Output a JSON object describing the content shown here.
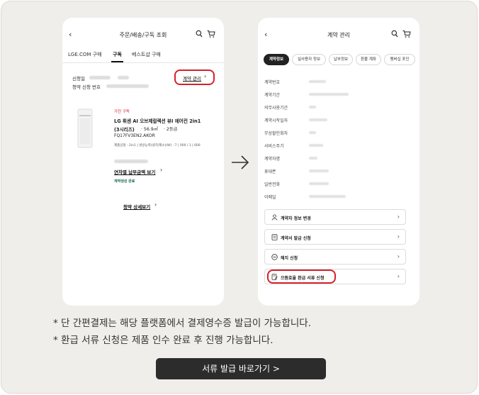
{
  "left": {
    "header": {
      "title": "주문/배송/구독 조회"
    },
    "tabs": [
      "LGE.COM 구매",
      "구독",
      "베스트샵 구매"
    ],
    "apply_date_label": "신청일",
    "contract_no_label": "청약 신청 번호",
    "contract_manage_link": "계약 관리",
    "product": {
      "category": "가전 구독",
      "name_line1": "LG 휘센 AI 오브제컬렉션 뷰I 에어컨 2in1",
      "name_line2": "(3시리즈)",
      "area": "· 56.9㎡",
      "grade": "· 2등급",
      "model": "FQ17FV3EN2.AKOR",
      "spec": "제품상형 : 2in1 | 냉방능력(냉치/제소)(W) : 7 | 000 / 1 | 600",
      "yearly_payment_link": "연차별 납부금액 보기",
      "status": "계약생성 완료"
    },
    "detail_link": "청약 상세보기"
  },
  "right": {
    "header": {
      "title": "계약 관리"
    },
    "chips": [
      "계약정보",
      "실사용자 정보",
      "납부정보",
      "환불 계좌",
      "멤버십 포인"
    ],
    "fields": [
      "계약번호",
      "계약기간",
      "의무사용기간",
      "계약시작일자",
      "무상할인회차",
      "서비스주기",
      "계약자명",
      "휴대폰",
      "일반전화",
      "이메일"
    ],
    "menu": [
      "계약자 정보 변경",
      "계약서 발급 신청",
      "해지 신청",
      "으뜸효율 환급 서류 신청"
    ]
  },
  "notes": [
    "* 단 간편결제는 해당 플랫폼에서 결제영수증 발급이 가능합니다.",
    "* 환급 서류 신청은 제품 인수 완료 후 진행 가능합니다."
  ],
  "cta_label": "서류 발급 바로가기 >",
  "colors": {
    "highlight": "#d4222b",
    "cta": "#2c2c2c",
    "panel": "#efeeea"
  }
}
